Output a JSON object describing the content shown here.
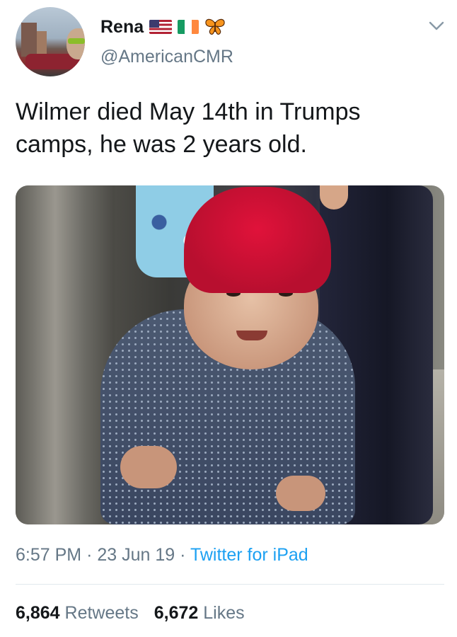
{
  "user": {
    "name": "Rena",
    "handle": "@AmericanCMR",
    "name_emoji_icons": [
      "us-flag-icon",
      "ireland-flag-icon",
      "butterfly-icon"
    ]
  },
  "tweet": {
    "text_line1": "Wilmer died May 14th in Trumps",
    "text_line2": "camps, he was 2 years old."
  },
  "meta": {
    "time": "6:57 PM",
    "separator": "·",
    "date": "23 Jun 19",
    "source": "Twitter for iPad"
  },
  "stats": {
    "retweets_count": "6,864",
    "retweets_label": "Retweets",
    "likes_count": "6,672",
    "likes_label": "Likes"
  },
  "colors": {
    "text": "#14171a",
    "secondary": "#657786",
    "link": "#1da1f2",
    "divider": "#e1e8ed",
    "ireland_green": "#169b62",
    "ireland_orange": "#ff883e"
  }
}
